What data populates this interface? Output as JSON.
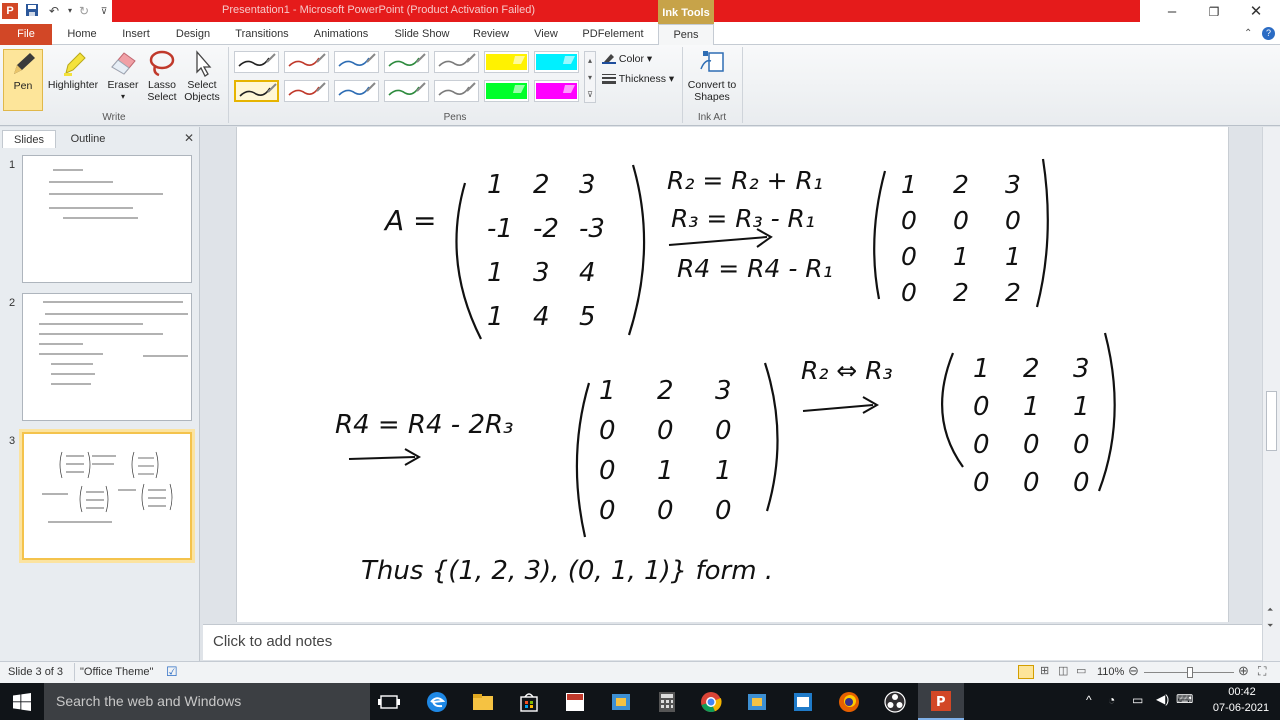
{
  "window": {
    "title": "Presentation1 - Microsoft PowerPoint (Product Activation Failed)",
    "contextual_tab_group": "Ink Tools"
  },
  "tabs": [
    "File",
    "Home",
    "Insert",
    "Design",
    "Transitions",
    "Animations",
    "Slide Show",
    "Review",
    "View",
    "PDFelement",
    "Pens"
  ],
  "ribbon": {
    "write_group": {
      "label": "Write",
      "pen": "Pen",
      "highlighter": "Highlighter",
      "eraser": "Eraser",
      "lasso": "Lasso Select",
      "select": "Select Objects"
    },
    "pens_group": {
      "label": "Pens",
      "color": "Color",
      "thickness": "Thickness"
    },
    "ink_art_group": {
      "label": "Ink Art",
      "convert": "Convert to Shapes"
    },
    "pen_colors": [
      "#222222",
      "#c0392b",
      "#2e6db4",
      "#2e8b3e",
      "#7b7b7b",
      "#fff200",
      "#00f0ff",
      "#222222",
      "#c0392b",
      "#2e6db4",
      "#2e8b3e",
      "#7b7b7b",
      "#00ff2a",
      "#ff00ff"
    ]
  },
  "left_panel": {
    "tabs": [
      "Slides",
      "Outline"
    ],
    "slides": [
      {
        "number": "1"
      },
      {
        "number": "2"
      },
      {
        "number": "3",
        "selected": true
      }
    ]
  },
  "notes": {
    "placeholder": "Click to add notes"
  },
  "status": {
    "slide_info": "Slide 3 of 3",
    "theme": "\"Office Theme\"",
    "zoom": "110%"
  },
  "taskbar": {
    "search_placeholder": "Search the web and Windows",
    "time": "00:42",
    "date": "07-06-2021"
  },
  "slide_ink": {
    "matrix_label": "A =",
    "matrix_A": [
      [
        "1",
        "2",
        "3"
      ],
      [
        "-1",
        "-2",
        "-3"
      ],
      [
        "1",
        "3",
        "4"
      ],
      [
        "1",
        "4",
        "5"
      ]
    ],
    "ops1": [
      "R₂ = R₂ + R₁",
      "R₃ = R₃ - R₁",
      "R4 = R4 - R₁"
    ],
    "matrix_B": [
      [
        "1",
        "2",
        "3"
      ],
      [
        "0",
        "0",
        "0"
      ],
      [
        "0",
        "1",
        "1"
      ],
      [
        "0",
        "2",
        "2"
      ]
    ],
    "op2": "R4 = R4 - 2R₃",
    "matrix_C": [
      [
        "1",
        "2",
        "3"
      ],
      [
        "0",
        "0",
        "0"
      ],
      [
        "0",
        "1",
        "1"
      ],
      [
        "0",
        "0",
        "0"
      ]
    ],
    "op3": "R₂ ⇔ R₃",
    "matrix_D": [
      [
        "1",
        "2",
        "3"
      ],
      [
        "0",
        "1",
        "1"
      ],
      [
        "0",
        "0",
        "0"
      ],
      [
        "0",
        "0",
        "0"
      ]
    ],
    "conclusion": "Thus {(1, 2, 3), (0, 1, 1)} form ."
  },
  "accent_colors": {
    "file_tab": "#d24726",
    "ink_tools": "#c7a349",
    "title_red": "#e51b1b"
  }
}
